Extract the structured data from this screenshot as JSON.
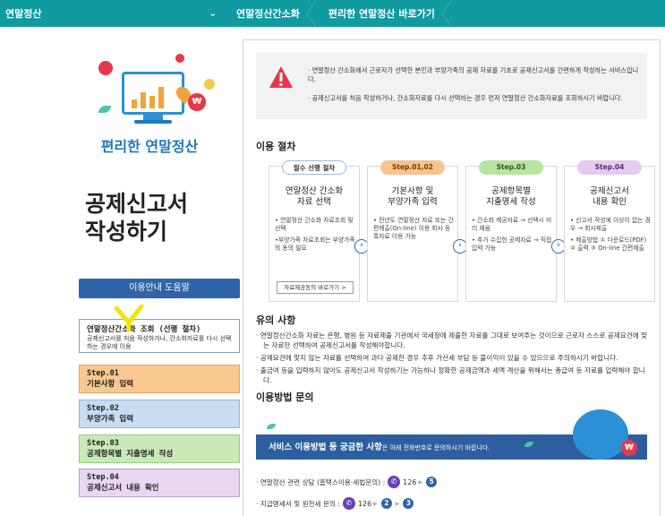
{
  "topbar": {
    "crumb1": "연말정산",
    "chevron": "chevron-down-icon",
    "crumb2": "연말정산간소화",
    "crumb3": "편리한 연말정산 바로가기",
    "color": "#0f9ba0"
  },
  "left": {
    "subtitle": "편리한 연말정산",
    "title_line1": "공제신고서",
    "title_line2": "작성하기",
    "guide_button": "이용안내 도움말",
    "pre_step": {
      "title": "연말정산간소화 조회 (선행 절차)",
      "desc": "공제신고서를 처음 작성하거나, 간소화자료를 다시 선택하는 경우에 이용"
    },
    "steps": [
      {
        "num": "Step.01",
        "label": "기본사항 입력"
      },
      {
        "num": "Step.02",
        "label": "부양가족 입력"
      },
      {
        "num": "Step.03",
        "label": "공제항목별 지출명세 작성"
      },
      {
        "num": "Step.04",
        "label": "공제신고서 내용 확인"
      }
    ]
  },
  "notice": {
    "p1": "· 연말정산 간소화에서 근로자가 선택한 본인과 부양가족의 공제 자료를 기초로 공제신고서를 간편하게 작성하는 서비스입니다.",
    "p2": "· 공제신고서를 처음 작성하거나, 간소화자료를 다시 선택하는 경우 먼저 연말정산 간소화자료를 조회하시기 바랍니다."
  },
  "procedure": {
    "title": "이용 절차",
    "boxes": [
      {
        "badge": "필수 선행 절차",
        "head1": "연말정산 간소화",
        "head2": "자료 선택",
        "items": [
          "• 연말정산 간소화 자료조회 및 선택",
          "•부양가족 자료조회는 부양가족의 동의 필요"
        ],
        "link": "자료제공동의 바로가기 >"
      },
      {
        "badge": "Step.01,02",
        "head1": "기본사항 및",
        "head2": "부양가족 입력",
        "items": [
          "• 전년도 연말정산 자료 또는 간편제출(On-line) 이용 회사 등록자료 이용 가능"
        ]
      },
      {
        "badge": "Step.03",
        "head1": "공제항목별",
        "head2": "지출명세 작성",
        "items": [
          "• 간소화 제공자료 → 선택시 미리 채움",
          "• 추가 수집한 공제자료 → 직접입력 가능"
        ]
      },
      {
        "badge": "Step.04",
        "head1": "공제신고서",
        "head2": "내용 확인",
        "items": [
          "• 신고서 작성에 이상이 없는 경우 → 회사제출",
          "• 제출방법 ① 다운로드(PDF) ② 출력 ③ On-line 간편제출"
        ]
      }
    ]
  },
  "caution": {
    "title": "유의 사항",
    "items": [
      "· 연말정산간소화 자료는 은행, 병원 등 자료제출 기관에서 국세청에 제출한 자료를 그대로 보여주는 것이므로 근로자 스스로 공제요건에 맞는 자료만 선택하여 공제신고서를 작성해야합니다.",
      "· 공제요건에 맞지 않는 자료를 선택하여 과다 공제한 경우 추후 가산세 부담 등 불이익이 있을 수 있으므로 주의하시기 바랍니다.",
      "· 출금여 등을 입력하지 않아도 공제신고서 작성하기는 가능하나 정확한 공제금액과 세액 계산을 위해서는 총급여 등 자료를 입력해야 합니다."
    ]
  },
  "contact": {
    "title": "이용방법 문의",
    "banner_main": "서비스 이용방법 등 궁금한 사항",
    "banner_sub": "은 아래 전화번호로 문의하시기 바랍니다.",
    "line1_label": "· 연말정산 관련 상담 (홈택스이용·세법문의) :",
    "line1_number": "126",
    "line1_steps": [
      "5"
    ],
    "line2_label": "· 지급명세서 및 원천세 문의 :",
    "line2_number": "126",
    "line2_steps": [
      "2",
      "3"
    ]
  }
}
